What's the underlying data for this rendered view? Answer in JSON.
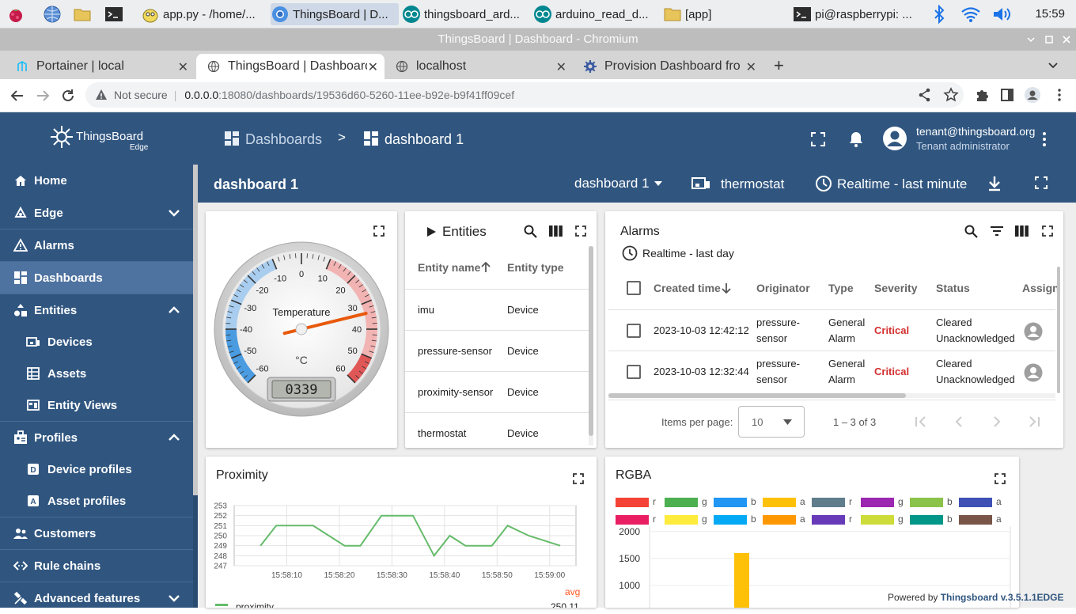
{
  "taskbar": {
    "items": [
      {
        "label": "app.py - /home/..."
      },
      {
        "label": "ThingsBoard | D..."
      },
      {
        "label": "thingsboard_ard..."
      },
      {
        "label": "arduino_read_d..."
      },
      {
        "label": "[app]"
      },
      {
        "label": "pi@raspberrypi: ..."
      }
    ],
    "clock": "15:59"
  },
  "browser": {
    "window_title": "ThingsBoard | Dashboard - Chromium",
    "tabs": [
      {
        "label": "Portainer | local"
      },
      {
        "label": "ThingsBoard | Dashboard"
      },
      {
        "label": "localhost"
      },
      {
        "label": "Provision Dashboard from"
      }
    ],
    "new_tab": "+",
    "url": {
      "security": "Not secure",
      "host": "0.0.0.0",
      "rest": ":18080/dashboards/19536d60-5260-11ee-b92e-b9f41ff09cef"
    }
  },
  "app": {
    "logo": {
      "name": "ThingsBoard",
      "sub": "Edge"
    },
    "breadcrumb": {
      "root": "Dashboards",
      "sep": ">",
      "current": "dashboard 1"
    },
    "user": {
      "email": "tenant@thingsboard.org",
      "role": "Tenant administrator"
    }
  },
  "sidebar": {
    "items": [
      {
        "label": "Home"
      },
      {
        "label": "Edge"
      },
      {
        "label": "Alarms"
      },
      {
        "label": "Dashboards"
      },
      {
        "label": "Entities"
      },
      {
        "label": "Devices"
      },
      {
        "label": "Assets"
      },
      {
        "label": "Entity Views"
      },
      {
        "label": "Profiles"
      },
      {
        "label": "Device profiles"
      },
      {
        "label": "Asset profiles"
      },
      {
        "label": "Customers"
      },
      {
        "label": "Rule chains"
      },
      {
        "label": "Advanced features"
      }
    ]
  },
  "dashbar": {
    "title": "dashboard 1",
    "selector": "dashboard 1",
    "entity": "thermostat",
    "timewindow": "Realtime - last minute"
  },
  "gauge": {
    "label": "Temperature",
    "unit": "°C",
    "value": "0339",
    "needle_value": 33.9,
    "min": -60,
    "max": 60,
    "ticks": [
      "-60",
      "-50",
      "-40",
      "-30",
      "-20",
      "-10",
      "0",
      "10",
      "20",
      "30",
      "40",
      "50",
      "60"
    ]
  },
  "entities": {
    "title": "Entities",
    "headers": [
      "Entity name",
      "Entity type"
    ],
    "rows": [
      {
        "name": "imu",
        "type": "Device"
      },
      {
        "name": "pressure-sensor",
        "type": "Device"
      },
      {
        "name": "proximity-sensor",
        "type": "Device"
      },
      {
        "name": "thermostat",
        "type": "Device"
      }
    ]
  },
  "alarms": {
    "title": "Alarms",
    "timewindow": "Realtime - last day",
    "headers": [
      "Created time",
      "Originator",
      "Type",
      "Severity",
      "Status",
      "Assign"
    ],
    "rows": [
      {
        "time": "2023-10-03 12:42:12",
        "orig1": "pressure-",
        "orig2": "sensor",
        "type1": "General",
        "type2": "Alarm",
        "severity": "Critical",
        "status1": "Cleared",
        "status2": "Unacknowledged"
      },
      {
        "time": "2023-10-03 12:32:44",
        "orig1": "pressure-",
        "orig2": "sensor",
        "type1": "General",
        "type2": "Alarm",
        "severity": "Critical",
        "status1": "Cleared",
        "status2": "Unacknowledged"
      }
    ],
    "pager": {
      "label": "Items per page:",
      "size": "10",
      "range": "1 – 3 of 3"
    }
  },
  "proximity": {
    "title": "Proximity",
    "legend_head": "avg",
    "legend_name": "proximity",
    "legend_value": "250.11",
    "line_color": "#66bb6a"
  },
  "rgba": {
    "title": "RGBA",
    "legend": [
      {
        "c": "#f44336",
        "l": "r"
      },
      {
        "c": "#4caf50",
        "l": "g"
      },
      {
        "c": "#2196f3",
        "l": "b"
      },
      {
        "c": "#ffc107",
        "l": "a"
      },
      {
        "c": "#607d8b",
        "l": "r"
      },
      {
        "c": "#9c27b0",
        "l": "g"
      },
      {
        "c": "#8bc34a",
        "l": "b"
      },
      {
        "c": "#3f51b5",
        "l": "a"
      },
      {
        "c": "#e91e63",
        "l": "r"
      },
      {
        "c": "#ffeb3b",
        "l": "g"
      },
      {
        "c": "#03a9f4",
        "l": "b"
      },
      {
        "c": "#ff9800",
        "l": "a"
      },
      {
        "c": "#673ab7",
        "l": "r"
      },
      {
        "c": "#cddc39",
        "l": "g"
      },
      {
        "c": "#009688",
        "l": "b"
      },
      {
        "c": "#795548",
        "l": "a"
      }
    ],
    "powered_prefix": "Powered by ",
    "powered_brand": "Thingsboard v.3.5.1.1EDGE"
  },
  "chart_data": [
    {
      "type": "line",
      "title": "Proximity",
      "x": [
        "15:58:05",
        "15:58:08",
        "15:58:15",
        "15:58:21",
        "15:58:24",
        "15:58:28",
        "15:58:34",
        "15:58:38",
        "15:58:41",
        "15:58:44",
        "15:58:49",
        "15:58:52",
        "15:58:56",
        "15:59:02"
      ],
      "xticks": [
        "15:58:10",
        "15:58:20",
        "15:58:30",
        "15:58:40",
        "15:58:50",
        "15:59:00"
      ],
      "yticks": [
        "247",
        "248",
        "249",
        "250",
        "251",
        "252",
        "253"
      ],
      "ylim": [
        247,
        253
      ],
      "series": [
        {
          "name": "proximity",
          "values": [
            249,
            251,
            251,
            249,
            249,
            252,
            252,
            248,
            250,
            249,
            249,
            251,
            250,
            249
          ]
        }
      ]
    },
    {
      "type": "bar",
      "title": "RGBA",
      "yticks": [
        "1000",
        "1500",
        "2000"
      ],
      "series": [
        {
          "name": "a",
          "values": [
            1600
          ]
        }
      ]
    }
  ]
}
